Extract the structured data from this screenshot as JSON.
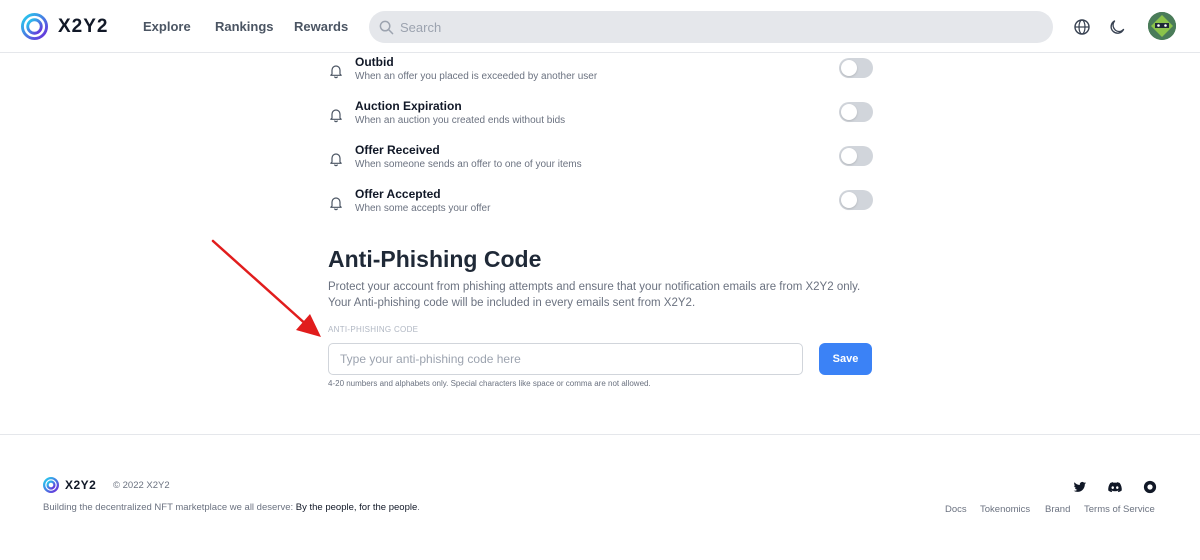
{
  "brand": {
    "name": "X2Y2",
    "accent": "#3b82f6"
  },
  "nav": {
    "items": [
      "Explore",
      "Rankings",
      "Rewards"
    ]
  },
  "search": {
    "placeholder": "Search"
  },
  "notifications": [
    {
      "title": "Outbid",
      "description": "When an offer you placed is exceeded by another user",
      "enabled": false
    },
    {
      "title": "Auction Expiration",
      "description": "When an auction you created ends without bids",
      "enabled": false
    },
    {
      "title": "Offer Received",
      "description": "When someone sends an offer to one of your items",
      "enabled": false
    },
    {
      "title": "Offer Accepted",
      "description": "When some accepts your offer",
      "enabled": false
    }
  ],
  "anti_phishing": {
    "heading": "Anti-Phishing Code",
    "description": "Protect your account from phishing attempts and ensure that your notification emails are from X2Y2 only. Your Anti-phishing code will be included in every emails sent from X2Y2.",
    "field_label": "ANTI-PHISHING CODE",
    "placeholder": "Type your anti-phishing code here",
    "value": "",
    "save_label": "Save",
    "hint": "4-20 numbers and alphabets only. Special characters like space or comma are not allowed."
  },
  "footer": {
    "brand": "X2Y2",
    "copyright": "© 2022 X2Y2",
    "tagline_prefix": "Building the decentralized NFT marketplace we all deserve: ",
    "tagline_emphasis": "By the people, for the people",
    "tagline_suffix": ".",
    "social": [
      "twitter-icon",
      "discord-icon",
      "opensea-icon"
    ],
    "links": [
      "Docs",
      "Tokenomics",
      "Brand",
      "Terms of Service"
    ]
  },
  "icons": {
    "language": "globe-icon",
    "theme": "moon-icon",
    "bell": "bell-icon"
  }
}
